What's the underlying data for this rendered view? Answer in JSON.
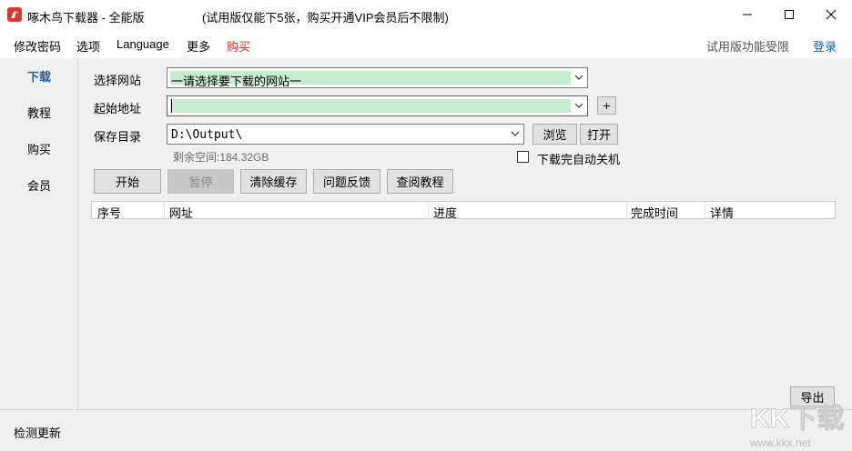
{
  "window": {
    "title": "啄木鸟下载器 - 全能版",
    "trial_note": "(试用版仅能下5张，购买开通VIP会员后不限制)"
  },
  "menu": {
    "change_password": "修改密码",
    "options": "选项",
    "language": "Language",
    "more": "更多",
    "buy": "购买",
    "trial_limit": "试用版功能受限",
    "login": "登录"
  },
  "nav": {
    "download": "下载",
    "tutorial": "教程",
    "buy": "购买",
    "member": "会员"
  },
  "form": {
    "site_label": "选择网站",
    "site_value": "一请选择要下载的网站一",
    "start_label": "起始地址",
    "start_value": "",
    "save_label": "保存目录",
    "save_value": "D:\\Output\\",
    "free_space": "剩余空间:184.32GB",
    "add_button": "+",
    "browse_button": "浏览",
    "open_button": "打开",
    "shutdown_label": "下载完自动关机"
  },
  "actions": {
    "start": "开始",
    "pause": "暂停",
    "clear_cache": "清除缓存",
    "feedback": "问题反馈",
    "view_tutorial": "查阅教程"
  },
  "table": {
    "columns": [
      "序号",
      "网址",
      "进度",
      "完成时间",
      "详情"
    ],
    "rows": []
  },
  "footer": {
    "export_button": "导出",
    "check_update": "检测更新",
    "watermark_text": "KK下载",
    "watermark_url": "www.kkx.net"
  },
  "colors": {
    "accent_blue": "#1f5fa8",
    "buy_red": "#d0312d",
    "combo_fill": "#c8ecd2",
    "logo_red": "#d93a2b"
  }
}
